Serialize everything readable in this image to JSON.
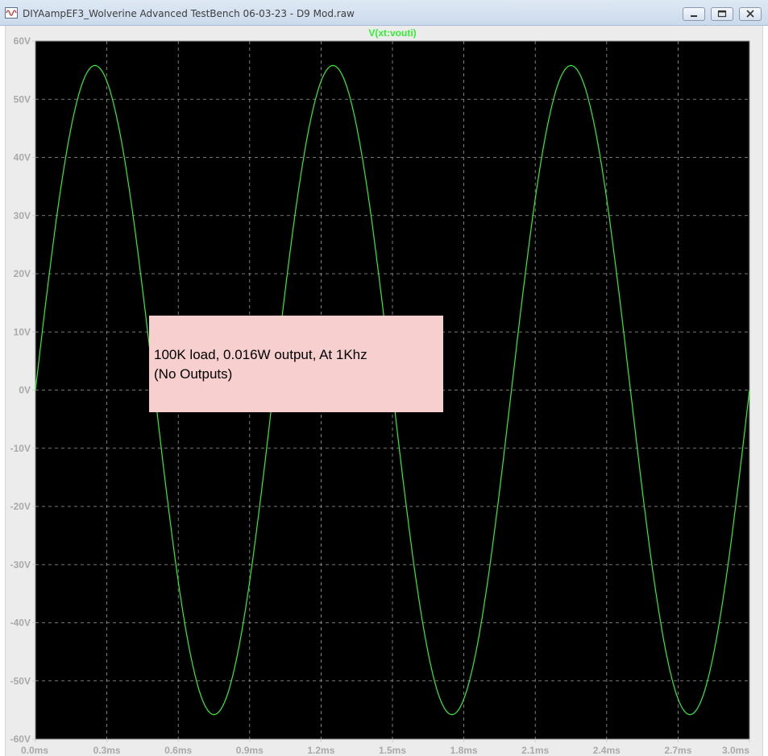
{
  "window": {
    "title": "DIYAampEF3_Wolverine Advanced TestBench 06-03-23 - D9 Mod.raw",
    "buttons": [
      "minimize",
      "maximize",
      "close"
    ]
  },
  "colors": {
    "background": "#000000",
    "trace": "#33ee33",
    "grid": "#9a9a9a",
    "tick_labels": "#a9a9a9",
    "annotation_bg": "#f7cfcf"
  },
  "annotation": {
    "line1": "100K load, 0.016W output, At 1Khz",
    "line2": "(No Outputs)"
  },
  "chart_data": {
    "type": "line",
    "title": "V(xt:vouti)",
    "xlabel": "",
    "ylabel": "",
    "grid": true,
    "xlim": [
      0,
      3.0
    ],
    "ylim": [
      -60,
      60
    ],
    "x_tick_labels": [
      "0.0ms",
      "0.3ms",
      "0.6ms",
      "0.9ms",
      "1.2ms",
      "1.5ms",
      "1.8ms",
      "2.1ms",
      "2.4ms",
      "2.7ms",
      "3.0ms"
    ],
    "x_ticks": [
      0,
      0.3,
      0.6,
      0.9,
      1.2,
      1.5,
      1.8,
      2.1,
      2.4,
      2.7,
      3.0
    ],
    "y_tick_labels": [
      "60V",
      "50V",
      "40V",
      "30V",
      "20V",
      "10V",
      "0V",
      "-10V",
      "-20V",
      "-30V",
      "-40V",
      "-50V",
      "-60V"
    ],
    "y_ticks": [
      60,
      50,
      40,
      30,
      20,
      10,
      0,
      -10,
      -20,
      -30,
      -40,
      -50,
      -60
    ],
    "series": [
      {
        "name": "V(xt:vouti)",
        "x": [
          0,
          0.05,
          0.1,
          0.15,
          0.2,
          0.25,
          0.3,
          0.35,
          0.4,
          0.45,
          0.5,
          0.55,
          0.6,
          0.65,
          0.7,
          0.75,
          0.8,
          0.85,
          0.9,
          0.95,
          1.0,
          1.05,
          1.1,
          1.15,
          1.2,
          1.25,
          1.3,
          1.35,
          1.4,
          1.45,
          1.5,
          1.55,
          1.6,
          1.65,
          1.7,
          1.75,
          1.8,
          1.85,
          1.9,
          1.95,
          2.0,
          2.05,
          2.1,
          2.15,
          2.2,
          2.25,
          2.3,
          2.35,
          2.4,
          2.45,
          2.5,
          2.55,
          2.6,
          2.65,
          2.7,
          2.75,
          2.8,
          2.85,
          2.9,
          2.95,
          3.0
        ],
        "y": [
          0,
          17.3,
          32.9,
          45.2,
          53.1,
          55.8,
          53.1,
          45.2,
          32.9,
          17.3,
          0,
          -17.3,
          -32.9,
          -45.2,
          -53.1,
          -55.8,
          -53.1,
          -45.2,
          -32.9,
          -17.3,
          0,
          17.3,
          32.9,
          45.2,
          53.1,
          55.8,
          53.1,
          45.2,
          32.9,
          17.3,
          0,
          -17.3,
          -32.9,
          -45.2,
          -53.1,
          -55.8,
          -53.1,
          -45.2,
          -32.9,
          -17.3,
          0,
          17.3,
          32.9,
          45.2,
          53.1,
          55.8,
          53.1,
          45.2,
          32.9,
          17.3,
          0,
          -17.3,
          -32.9,
          -45.2,
          -53.1,
          -55.8,
          -53.1,
          -45.2,
          -32.9,
          -17.3,
          0
        ]
      }
    ]
  }
}
